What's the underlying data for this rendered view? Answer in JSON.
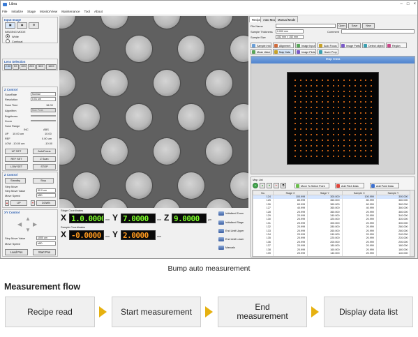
{
  "window": {
    "title": "Libra",
    "controls": [
      "–",
      "□",
      "×"
    ]
  },
  "menu": [
    "File",
    "Initialize",
    "Stage",
    "MonitorView",
    "Maintenance",
    "Tool",
    "About"
  ],
  "left": {
    "input_image": {
      "title": "Input Image",
      "imaging_mode_label": "IMAGING MODE",
      "white_label": "White",
      "confocal_label": "Confocal"
    },
    "lens": {
      "title": "Lens Selection",
      "buttons": [
        "2.5X",
        "5X",
        "10X",
        "20X",
        "50X",
        "100X"
      ]
    },
    "z_control": {
      "title": "Z Control",
      "scan_rate_label": "ScanRate",
      "scan_rate_value": "Normal",
      "resolution_label": "Resolution",
      "resolution_value": "0.01 um",
      "scan_time_label": "Scan Time",
      "scan_time_value": "16.00",
      "algorithm_label": "Algorithm",
      "algorithm_value": "Max Peak",
      "brightness_label": "Brightness",
      "zoom_label": "Zoom",
      "scan_range_label": "Scan Range",
      "inc_label": "INC",
      "abs_label": "ABS",
      "up_label": "UP",
      "up_value": "10.00 um",
      "up_abs": "10.00",
      "ref_label": "REF",
      "ref_value": "0.00 um",
      "low_label": "LOW",
      "low_value": "-10.00 um",
      "low_abs": "-10.00",
      "up_set": "UP SET",
      "autofocus": "AutoFocus",
      "ref_set": "REF SET",
      "zscan": "Z Scan",
      "low_set": "LOW SET",
      "stop": "STOP"
    },
    "z_control2": {
      "title": "Z Control",
      "standby": "Standby",
      "stop": "Stop",
      "step_move_label": "Step Move",
      "step_move_value": "Step Move Value",
      "step_value": "50.0 um",
      "move_speed_label": "Move Speed",
      "move_speed_value": "MID",
      "up": "UP",
      "down": "DOWN"
    },
    "xy_control": {
      "title": "XY Control",
      "step_move_label": "Step Move Value",
      "step_value": "1000 um",
      "move_speed_label": "Move Speed",
      "move_speed_value": "MID",
      "load_pos": "Load Pos",
      "start_pos": "Start Pos"
    }
  },
  "coords": {
    "stage_label": "Stage Coordinates",
    "sample_label": "Sample Coordinates",
    "stage": {
      "x": "1.0.0000",
      "y": "7.0000",
      "z": "9.0000"
    },
    "sample": {
      "x": "-0.0000",
      "y": "2.0000"
    },
    "unit_mm": "mm",
    "unit_um": "µm",
    "actions": [
      "Initialized Zoom",
      "Initialized Stage",
      "End Limit Upper",
      "End Limit Lower",
      "Manuals"
    ],
    "colors": {
      "stage": "#7dff2a",
      "sample": "#ff9a1f"
    }
  },
  "right": {
    "tabs": [
      "Recipe",
      "Auto Mode",
      "Manual Mode"
    ],
    "file_name_label": "File Name",
    "file_name_value": "",
    "sample_thickness_label": "Sample Thickness",
    "sample_thickness_value": "0.000 mm",
    "sample_size_label": "Sample Size",
    "sample_size_value": "152 mm × 152 mm",
    "comment_label": "Comment",
    "open": "Open",
    "save": "Save",
    "new": "New",
    "ribbon_row1": [
      "Sample Info",
      "Alignment",
      "Image Input",
      "Auto Focus",
      "Image Parts",
      "Detect object",
      "Region"
    ],
    "ribbon_row2": [
      "Mean Value",
      "Map Data",
      "Image Plots",
      "Hover Prop"
    ],
    "map_title": "Map Data",
    "map_list_title": "Map List",
    "toolbar": [
      "Move To Select Point",
      "Add Pitch Data",
      "Add Point Data"
    ],
    "columns": [
      "No.",
      "Stage X",
      "Stage Y",
      "Sample X",
      "Sample Y"
    ],
    "rows": [
      [
        "124",
        "100.999",
        "300.000",
        "100.999",
        "300.000"
      ],
      [
        "125",
        "80.999",
        "360.000",
        "80.999",
        "360.000"
      ],
      [
        "126",
        "60.999",
        "360.000",
        "60.999",
        "360.000"
      ],
      [
        "127",
        "40.999",
        "360.000",
        "40.999",
        "360.000"
      ],
      [
        "128",
        "20.999",
        "360.000",
        "20.999",
        "360.000"
      ],
      [
        "129",
        "20.999",
        "340.000",
        "20.999",
        "340.000"
      ],
      [
        "130",
        "20.999",
        "320.000",
        "20.999",
        "320.000"
      ],
      [
        "131",
        "20.999",
        "300.000",
        "20.999",
        "300.000"
      ],
      [
        "132",
        "20.999",
        "280.000",
        "20.999",
        "280.000"
      ],
      [
        "133",
        "20.999",
        "260.000",
        "20.999",
        "260.000"
      ],
      [
        "134",
        "20.999",
        "240.000",
        "20.999",
        "240.000"
      ],
      [
        "135",
        "20.999",
        "220.000",
        "20.999",
        "220.000"
      ],
      [
        "136",
        "20.999",
        "200.000",
        "20.999",
        "200.000"
      ],
      [
        "137",
        "20.999",
        "180.000",
        "20.999",
        "180.000"
      ],
      [
        "138",
        "20.999",
        "160.000",
        "20.999",
        "160.000"
      ],
      [
        "139",
        "20.999",
        "140.000",
        "20.999",
        "140.000"
      ],
      [
        "140",
        "20.999",
        "120.000",
        "20.999",
        "120.000"
      ],
      [
        "141",
        "20.999",
        "100.000",
        "20.999",
        "100.000"
      ],
      [
        "142",
        "20.999",
        "80.000",
        "20.999",
        "80.000"
      ]
    ],
    "map_dot_color": "#ff7a1a"
  },
  "caption": "Bump auto measurement",
  "flow": {
    "title": "Measurement flow",
    "steps": [
      "Recipe read",
      "Start measurement",
      "End measurement",
      "Display data list"
    ],
    "arrow_color": "#e6b110"
  }
}
